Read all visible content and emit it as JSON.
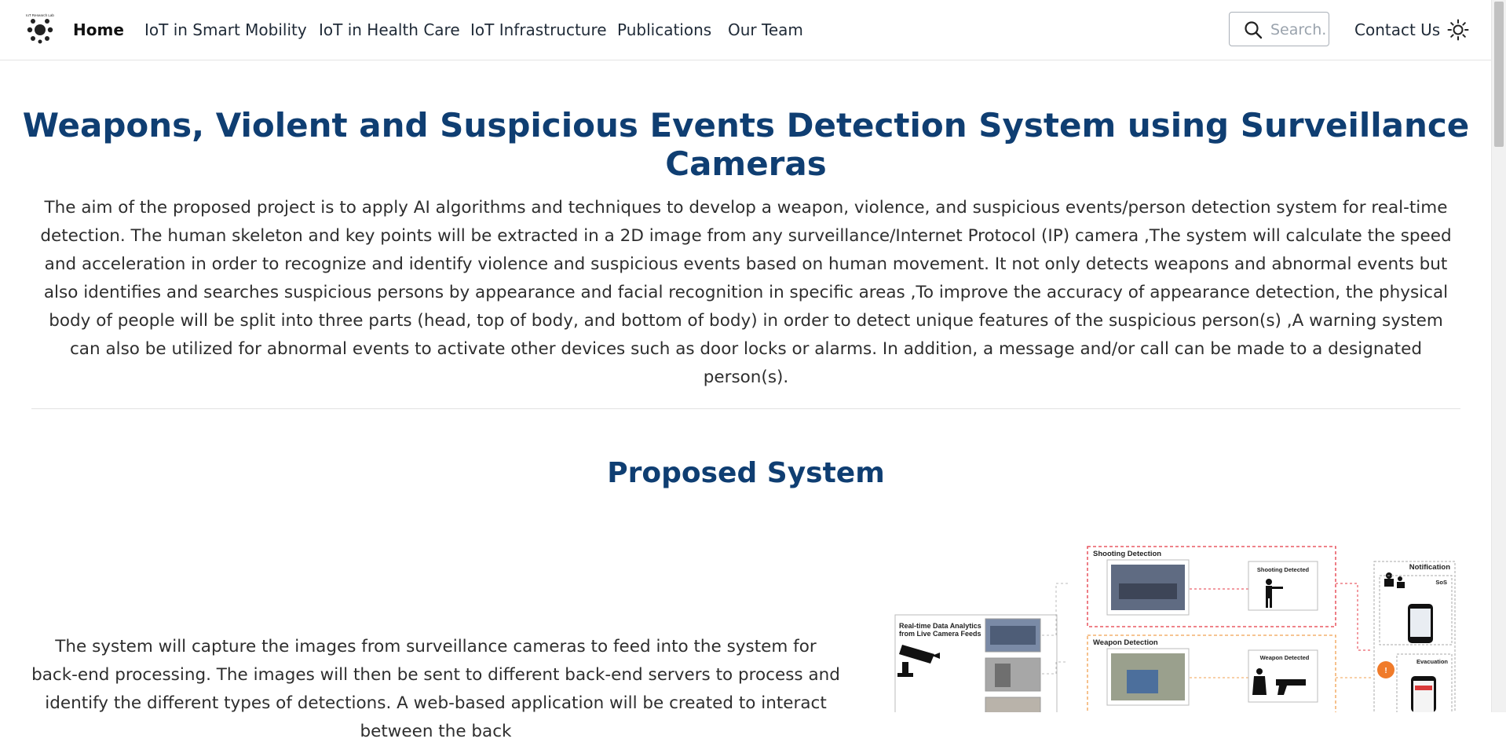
{
  "nav": {
    "logo_text": "IoT Research Lab",
    "links": [
      "Home",
      "IoT in Smart Mobility",
      "IoT in Health Care",
      "IoT Infrastructure",
      "Publications",
      "Our Team"
    ],
    "search_placeholder": "Search...",
    "contact_label": "Contact Us"
  },
  "page": {
    "title": "Weapons, Violent and Suspicious Events Detection System using Surveillance Cameras",
    "intro": "The aim of the proposed project is to apply AI algorithms and techniques to develop a weapon, violence, and suspicious events/person detection system for real-time detection. The human skeleton and key points will be extracted in a 2D image from any surveillance/Internet Protocol (IP) camera ,The system will calculate the speed and acceleration in order to recognize and identify violence and suspicious events based on human movement. It not only detects weapons and abnormal events but also identifies and searches suspicious persons by appearance and facial recognition in specific areas ,To improve the accuracy of appearance detection, the physical body of people will be split into three parts (head, top of body, and bottom of body) in order to detect unique features of the suspicious person(s) ,A warning system can also be utilized for abnormal events to activate other devices such as door locks or alarms. In addition, a message and/or call can be made to a designated person(s).",
    "section_title": "Proposed System",
    "section_text": "The system will capture the images from surveillance cameras to feed into the system for back-end processing. The images will then be sent to different back-end servers to process and identify the different types of detections. A web-based application will be created to interact between the back"
  },
  "diagram": {
    "camera_label_1": "Real-time Data Analytics",
    "camera_label_2": "from Live Camera Feeds",
    "shooting_title": "Shooting Detection",
    "shooting_detected": "Shooting Detected",
    "weapon_title": "Weapon Detection",
    "weapon_detected": "Weapon Detected",
    "notification_title": "Notification",
    "sos_label": "SoS",
    "evacuation_label": "Evacuation"
  },
  "colors": {
    "title": "#0f3e72",
    "shooting_border": "#e53945",
    "weapon_border": "#f0a050",
    "evac_badge": "#f07b2a"
  }
}
